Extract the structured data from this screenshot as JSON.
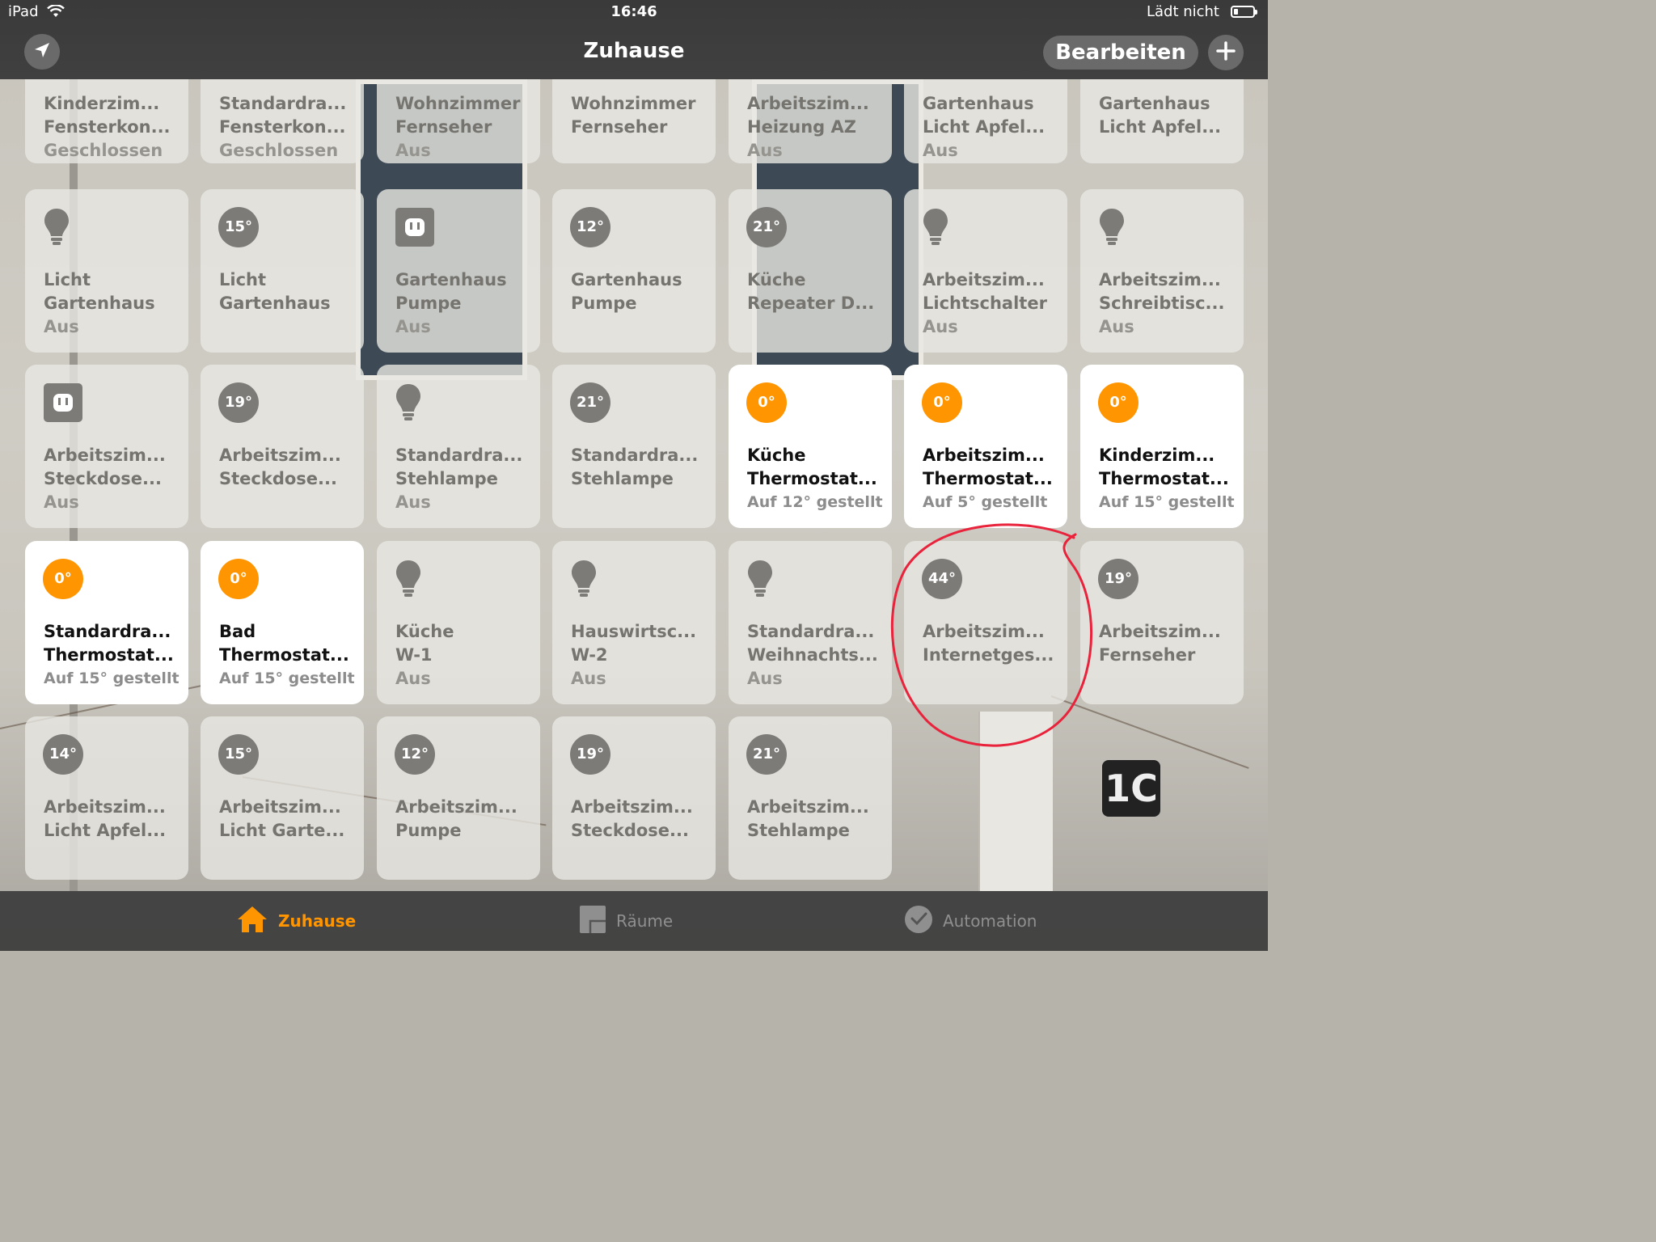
{
  "status_bar": {
    "device": "iPad",
    "time": "16:46",
    "charging": "Lädt nicht"
  },
  "header": {
    "title": "Zuhause",
    "edit_label": "Bearbeiten"
  },
  "accent_color": "#ff9500",
  "tiles": [
    {
      "name1": "Kinderzim...",
      "name2": "Fensterkon...",
      "status": "Geschlossen",
      "icon": "contact-sensor-icon"
    },
    {
      "name1": "Standardra...",
      "name2": "Fensterkon...",
      "status": "Geschlossen",
      "icon": "contact-sensor-icon"
    },
    {
      "name1": "Wohnzimmer",
      "name2": "Fernseher",
      "status": "Aus",
      "icon": "outlet-icon"
    },
    {
      "name1": "Wohnzimmer",
      "name2": "Fernseher",
      "status": "",
      "icon": "temperature-icon"
    },
    {
      "name1": "Arbeitszim...",
      "name2": "Heizung AZ",
      "status": "Aus",
      "icon": "outlet-icon"
    },
    {
      "name1": "Gartenhaus",
      "name2": "Licht Apfel...",
      "status": "Aus",
      "icon": "lightbulb-icon"
    },
    {
      "name1": "Gartenhaus",
      "name2": "Licht Apfel...",
      "status": "",
      "icon": "temperature-icon"
    },
    {
      "name1": "Licht",
      "name2": "Gartenhaus",
      "status": "Aus",
      "icon": "lightbulb-icon"
    },
    {
      "name1": "Licht",
      "name2": "Gartenhaus",
      "status": "",
      "badge": "15°"
    },
    {
      "name1": "Gartenhaus",
      "name2": "Pumpe",
      "status": "Aus",
      "icon": "outlet-icon"
    },
    {
      "name1": "Gartenhaus",
      "name2": "Pumpe",
      "status": "",
      "badge": "12°"
    },
    {
      "name1": "Küche",
      "name2": "Repeater D...",
      "status": "",
      "badge": "21°"
    },
    {
      "name1": "Arbeitszim...",
      "name2": "Lichtschalter",
      "status": "Aus",
      "icon": "lightbulb-icon"
    },
    {
      "name1": "Arbeitszim...",
      "name2": "Schreibtisc...",
      "status": "Aus",
      "icon": "lightbulb-icon"
    },
    {
      "name1": "Arbeitszim...",
      "name2": "Steckdose...",
      "status": "Aus",
      "icon": "outlet-icon"
    },
    {
      "name1": "Arbeitszim...",
      "name2": "Steckdose...",
      "status": "",
      "badge": "19°"
    },
    {
      "name1": "Standardra...",
      "name2": "Stehlampe",
      "status": "Aus",
      "icon": "lightbulb-icon"
    },
    {
      "name1": "Standardra...",
      "name2": "Stehlampe",
      "status": "",
      "badge": "21°"
    },
    {
      "name1": "Küche",
      "name2": "Thermostat...",
      "status": "Auf 12° gestellt",
      "badge": "0°",
      "active": true
    },
    {
      "name1": "Arbeitszim...",
      "name2": "Thermostat...",
      "status": "Auf 5° gestellt",
      "badge": "0°",
      "active": true
    },
    {
      "name1": "Kinderzim...",
      "name2": "Thermostat...",
      "status": "Auf 15° gestellt",
      "badge": "0°",
      "active": true
    },
    {
      "name1": "Standardra...",
      "name2": "Thermostat...",
      "status": "Auf 15° gestellt",
      "badge": "0°",
      "active": true
    },
    {
      "name1": "Bad",
      "name2": "Thermostat...",
      "status": "Auf 15° gestellt",
      "badge": "0°",
      "active": true
    },
    {
      "name1": "Küche",
      "name2": "W-1",
      "status": "Aus",
      "icon": "lightbulb-icon"
    },
    {
      "name1": "Hauswirtsc...",
      "name2": "W-2",
      "status": "Aus",
      "icon": "lightbulb-icon"
    },
    {
      "name1": "Standardra...",
      "name2": "Weihnachts...",
      "status": "Aus",
      "icon": "lightbulb-icon"
    },
    {
      "name1": "Arbeitszim...",
      "name2": "Internetges...",
      "status": "",
      "badge": "44°"
    },
    {
      "name1": "Arbeitszim...",
      "name2": "Fernseher",
      "status": "",
      "badge": "19°"
    },
    {
      "name1": "Arbeitszim...",
      "name2": "Licht Apfel...",
      "status": "",
      "badge": "14°"
    },
    {
      "name1": "Arbeitszim...",
      "name2": "Licht Garte...",
      "status": "",
      "badge": "15°"
    },
    {
      "name1": "Arbeitszim...",
      "name2": "Pumpe",
      "status": "",
      "badge": "12°"
    },
    {
      "name1": "Arbeitszim...",
      "name2": "Steckdose...",
      "status": "",
      "badge": "19°"
    },
    {
      "name1": "Arbeitszim...",
      "name2": "Stehlampe",
      "status": "",
      "badge": "21°"
    }
  ],
  "tabs": [
    {
      "label": "Zuhause",
      "icon": "house-icon",
      "selected": true
    },
    {
      "label": "Räume",
      "icon": "rooms-icon",
      "selected": false
    },
    {
      "label": "Automation",
      "icon": "automation-icon",
      "selected": false
    }
  ],
  "background_number": "1C"
}
